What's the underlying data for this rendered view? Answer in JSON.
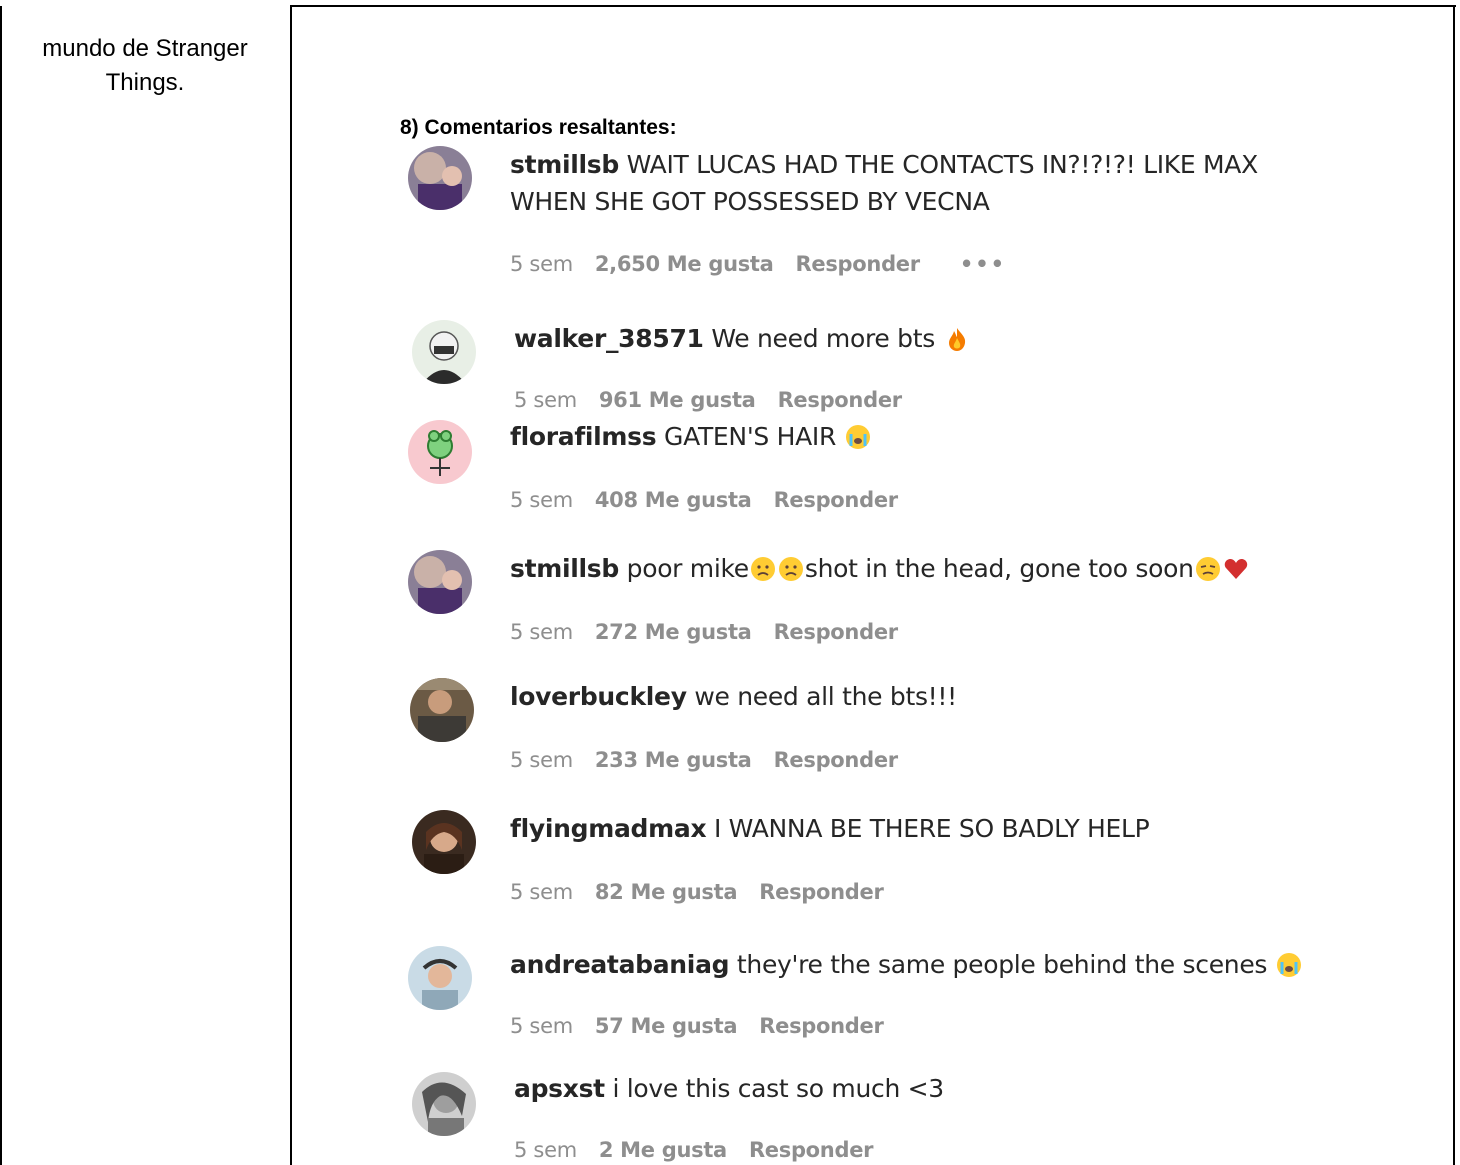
{
  "left_cell": {
    "text": "mundo de Stranger Things."
  },
  "section_title": "8) Comentarios resaltantes:",
  "comments": [
    {
      "user": "stmillsb",
      "text": "WAIT LUCAS HAD THE CONTACTS IN?!?!?! LIKE MAX WHEN SHE GOT POSSESSED BY VECNA",
      "time": "5 sem",
      "likes": "2,650 Me gusta",
      "reply": "Responder",
      "more": "•••"
    },
    {
      "user": "walker_38571",
      "text": "We need more bts",
      "time": "5 sem",
      "likes": "961 Me gusta",
      "reply": "Responder"
    },
    {
      "user": "florafilmss",
      "text": "GATEN'S HAIR",
      "time": "5 sem",
      "likes": "408 Me gusta",
      "reply": "Responder"
    },
    {
      "user": "stmillsb",
      "text": "poor mike",
      "text2": "shot in the head, gone too soon",
      "time": "5 sem",
      "likes": "272 Me gusta",
      "reply": "Responder"
    },
    {
      "user": "loverbuckley",
      "text": "we need all the bts!!!",
      "time": "5 sem",
      "likes": "233 Me gusta",
      "reply": "Responder"
    },
    {
      "user": "flyingmadmax",
      "text": "I WANNA BE THERE SO BADLY HELP",
      "time": "5 sem",
      "likes": "82 Me gusta",
      "reply": "Responder"
    },
    {
      "user": "andreatabaniag",
      "text": "they're the same people behind the scenes",
      "time": "5 sem",
      "likes": "57 Me gusta",
      "reply": "Responder"
    },
    {
      "user": "apsxst",
      "text": "i love this cast so much <3",
      "time": "5 sem",
      "likes": "2 Me gusta",
      "reply": "Responder"
    }
  ],
  "icons": [
    "fire-emoji-icon",
    "crying-emoji-icon",
    "sad-emoji-icon",
    "worried-emoji-icon",
    "red-heart-icon",
    "more-options-icon"
  ]
}
